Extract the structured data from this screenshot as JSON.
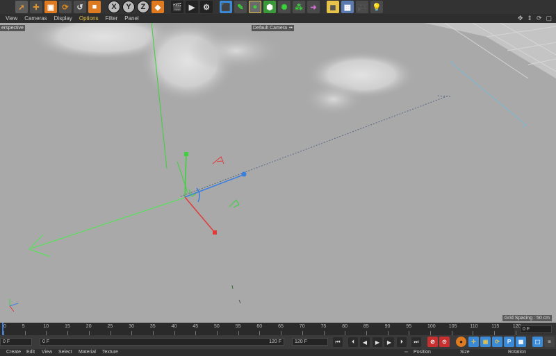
{
  "toolbar": {
    "axis_x": "X",
    "axis_y": "Y",
    "axis_z": "Z"
  },
  "menu": {
    "view": "View",
    "cameras": "Cameras",
    "display": "Display",
    "options": "Options",
    "filter": "Filter",
    "panel": "Panel"
  },
  "viewport": {
    "label": "erspective",
    "camera": "Default Camera",
    "camera_icon": "••",
    "grid_spacing": "Grid Spacing : 50 cm"
  },
  "timeline": {
    "ticks": [
      "0",
      "5",
      "10",
      "15",
      "20",
      "25",
      "30",
      "35",
      "40",
      "45",
      "50",
      "55",
      "60",
      "65",
      "70",
      "75",
      "80",
      "85",
      "90",
      "95",
      "100",
      "105",
      "110",
      "115",
      "120"
    ],
    "current_frame": "0 F"
  },
  "transport": {
    "field1": "0 F",
    "field2": "0 F",
    "field3": "120 F",
    "field4": "120 F"
  },
  "bottom_menu": {
    "create": "Create",
    "edit": "Edit",
    "view": "View",
    "select": "Select",
    "material": "Material",
    "texture": "Texture",
    "position": "Position",
    "size": "Size",
    "rotation": "Rotation"
  },
  "colors": {
    "x_axis": "#e03a3a",
    "y_axis": "#3ad33a",
    "z_axis": "#3a7ee0",
    "options_active": "#e6c34a"
  }
}
